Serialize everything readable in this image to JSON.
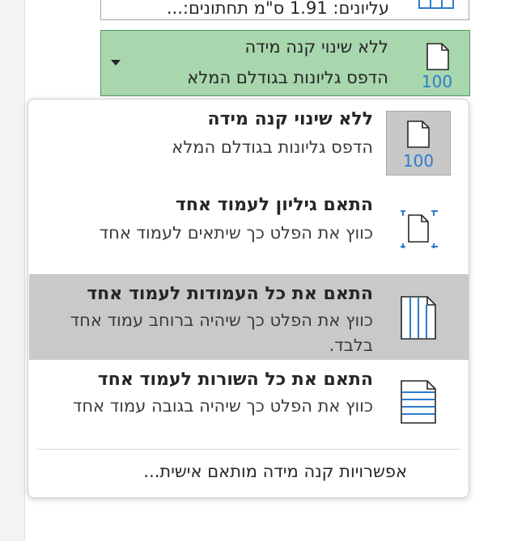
{
  "previous_option": {
    "text": "עליונים: 1.91 ס\"מ תחתונים:...",
    "icon": "margins-table-icon"
  },
  "scaling_dropdown": {
    "selected_title": "ללא שינוי קנה מידה",
    "selected_desc": "הדפס גליונות בגודלם המלא",
    "icon": "page-100-icon",
    "icon_label": "100",
    "arrow_icon": "dropdown-arrow-icon",
    "bg_color": "#a8d6ad"
  },
  "menu": {
    "items": [
      {
        "title": "ללא שינוי קנה מידה",
        "desc": "הדפס גליונות בגודלם המלא",
        "icon": "page-100-icon",
        "icon_label": "100",
        "hovered": false
      },
      {
        "title": "התאם גיליון לעמוד אחד",
        "desc": "כווץ את הפלט כך שיתאים לעמוד אחד",
        "icon": "fit-sheet-one-page-icon",
        "hovered": false
      },
      {
        "title": "התאם את כל העמודות לעמוד אחד",
        "desc": "כווץ את הפלט כך שיהיה ברוחב עמוד אחד בלבד.",
        "icon": "fit-columns-one-page-icon",
        "hovered": true
      },
      {
        "title": "התאם את כל השורות לעמוד אחד",
        "desc": "כווץ את הפלט כך שיהיה בגובה עמוד אחד",
        "icon": "fit-rows-one-page-icon",
        "hovered": false
      }
    ],
    "custom_options": "אפשרויות קנה מידה מותאם אישית..."
  },
  "colors": {
    "accent_blue": "#2e7bcf",
    "hover_gray": "#c9c9c9"
  }
}
